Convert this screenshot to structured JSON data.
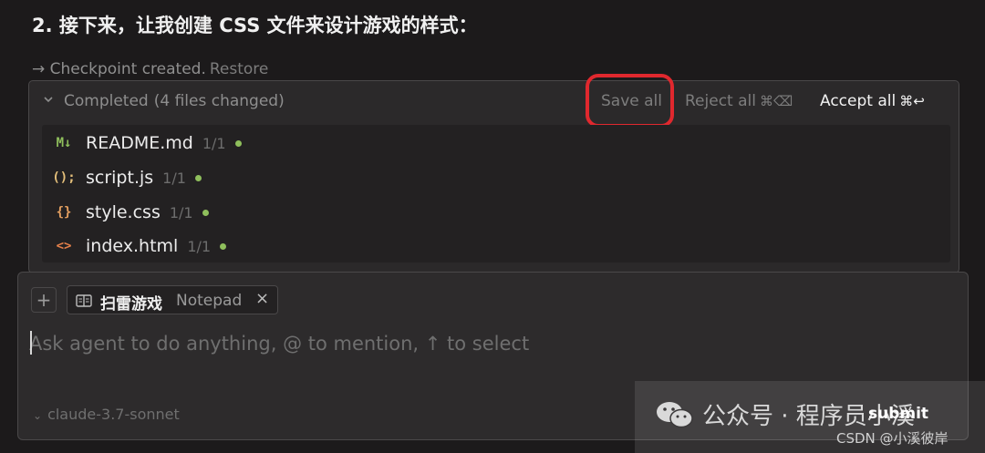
{
  "heading": "2. 接下来，让我创建 CSS 文件来设计游戏的样式：",
  "checkpoint": {
    "text": "→ Checkpoint created.",
    "restore": "Restore"
  },
  "changes": {
    "status": "Completed",
    "count": "(4 files changed)",
    "save_all": "Save all",
    "reject_all": "Reject all",
    "reject_shortcut": "⌘⌫",
    "accept_all": "Accept all",
    "accept_shortcut": "⌘↩",
    "highlight_color": "#e0282e",
    "files": [
      {
        "icon": "M↓",
        "icon_color": "#8fbf5c",
        "name": "README.md",
        "count": "1/1"
      },
      {
        "icon": "();",
        "icon_color": "#e5c07b",
        "name": "script.js",
        "count": "1/1"
      },
      {
        "icon": "{}",
        "icon_color": "#e5a060",
        "name": "style.css",
        "count": "1/1"
      },
      {
        "icon": "<>",
        "icon_color": "#e5804a",
        "name": "index.html",
        "count": "1/1"
      }
    ]
  },
  "composer": {
    "plus": "+",
    "tag_title": "扫雷游戏",
    "tag_sub": "Notepad",
    "tag_close": "×",
    "placeholder": "Ask agent to do anything, @ to mention, ↑ to select",
    "model": "claude-3.7-sonnet",
    "submit": "submit"
  },
  "watermark": {
    "text": "公众号 · 程序员小溪",
    "csdn": "CSDN @小溪彼岸"
  }
}
